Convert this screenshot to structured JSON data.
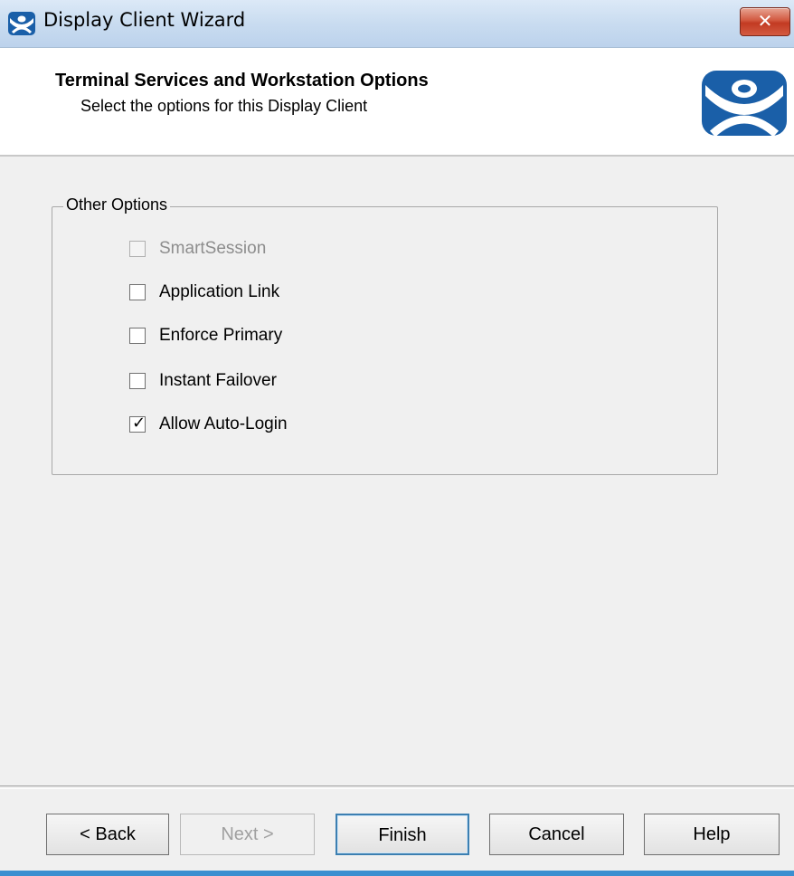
{
  "window": {
    "title": "Display Client Wizard",
    "close_label": "✕"
  },
  "header": {
    "title": "Terminal Services and Workstation Options",
    "subtitle": "Select the options for this Display Client"
  },
  "group": {
    "label": "Other Options",
    "options": [
      {
        "label": "SmartSession",
        "checked": false,
        "enabled": false
      },
      {
        "label": "Application Link",
        "checked": false,
        "enabled": true
      },
      {
        "label": "Enforce Primary",
        "checked": false,
        "enabled": true
      },
      {
        "label": "Instant Failover",
        "checked": false,
        "enabled": true
      },
      {
        "label": "Allow Auto-Login",
        "checked": true,
        "enabled": true
      }
    ]
  },
  "buttons": {
    "back": "< Back",
    "next": "Next >",
    "finish": "Finish",
    "cancel": "Cancel",
    "help": "Help"
  },
  "colors": {
    "logo_blue": "#1a5fa8",
    "accent": "#3a8fd0"
  },
  "icons": {
    "title_icon": "thinmanager-icon",
    "logo": "thinmanager-logo"
  }
}
